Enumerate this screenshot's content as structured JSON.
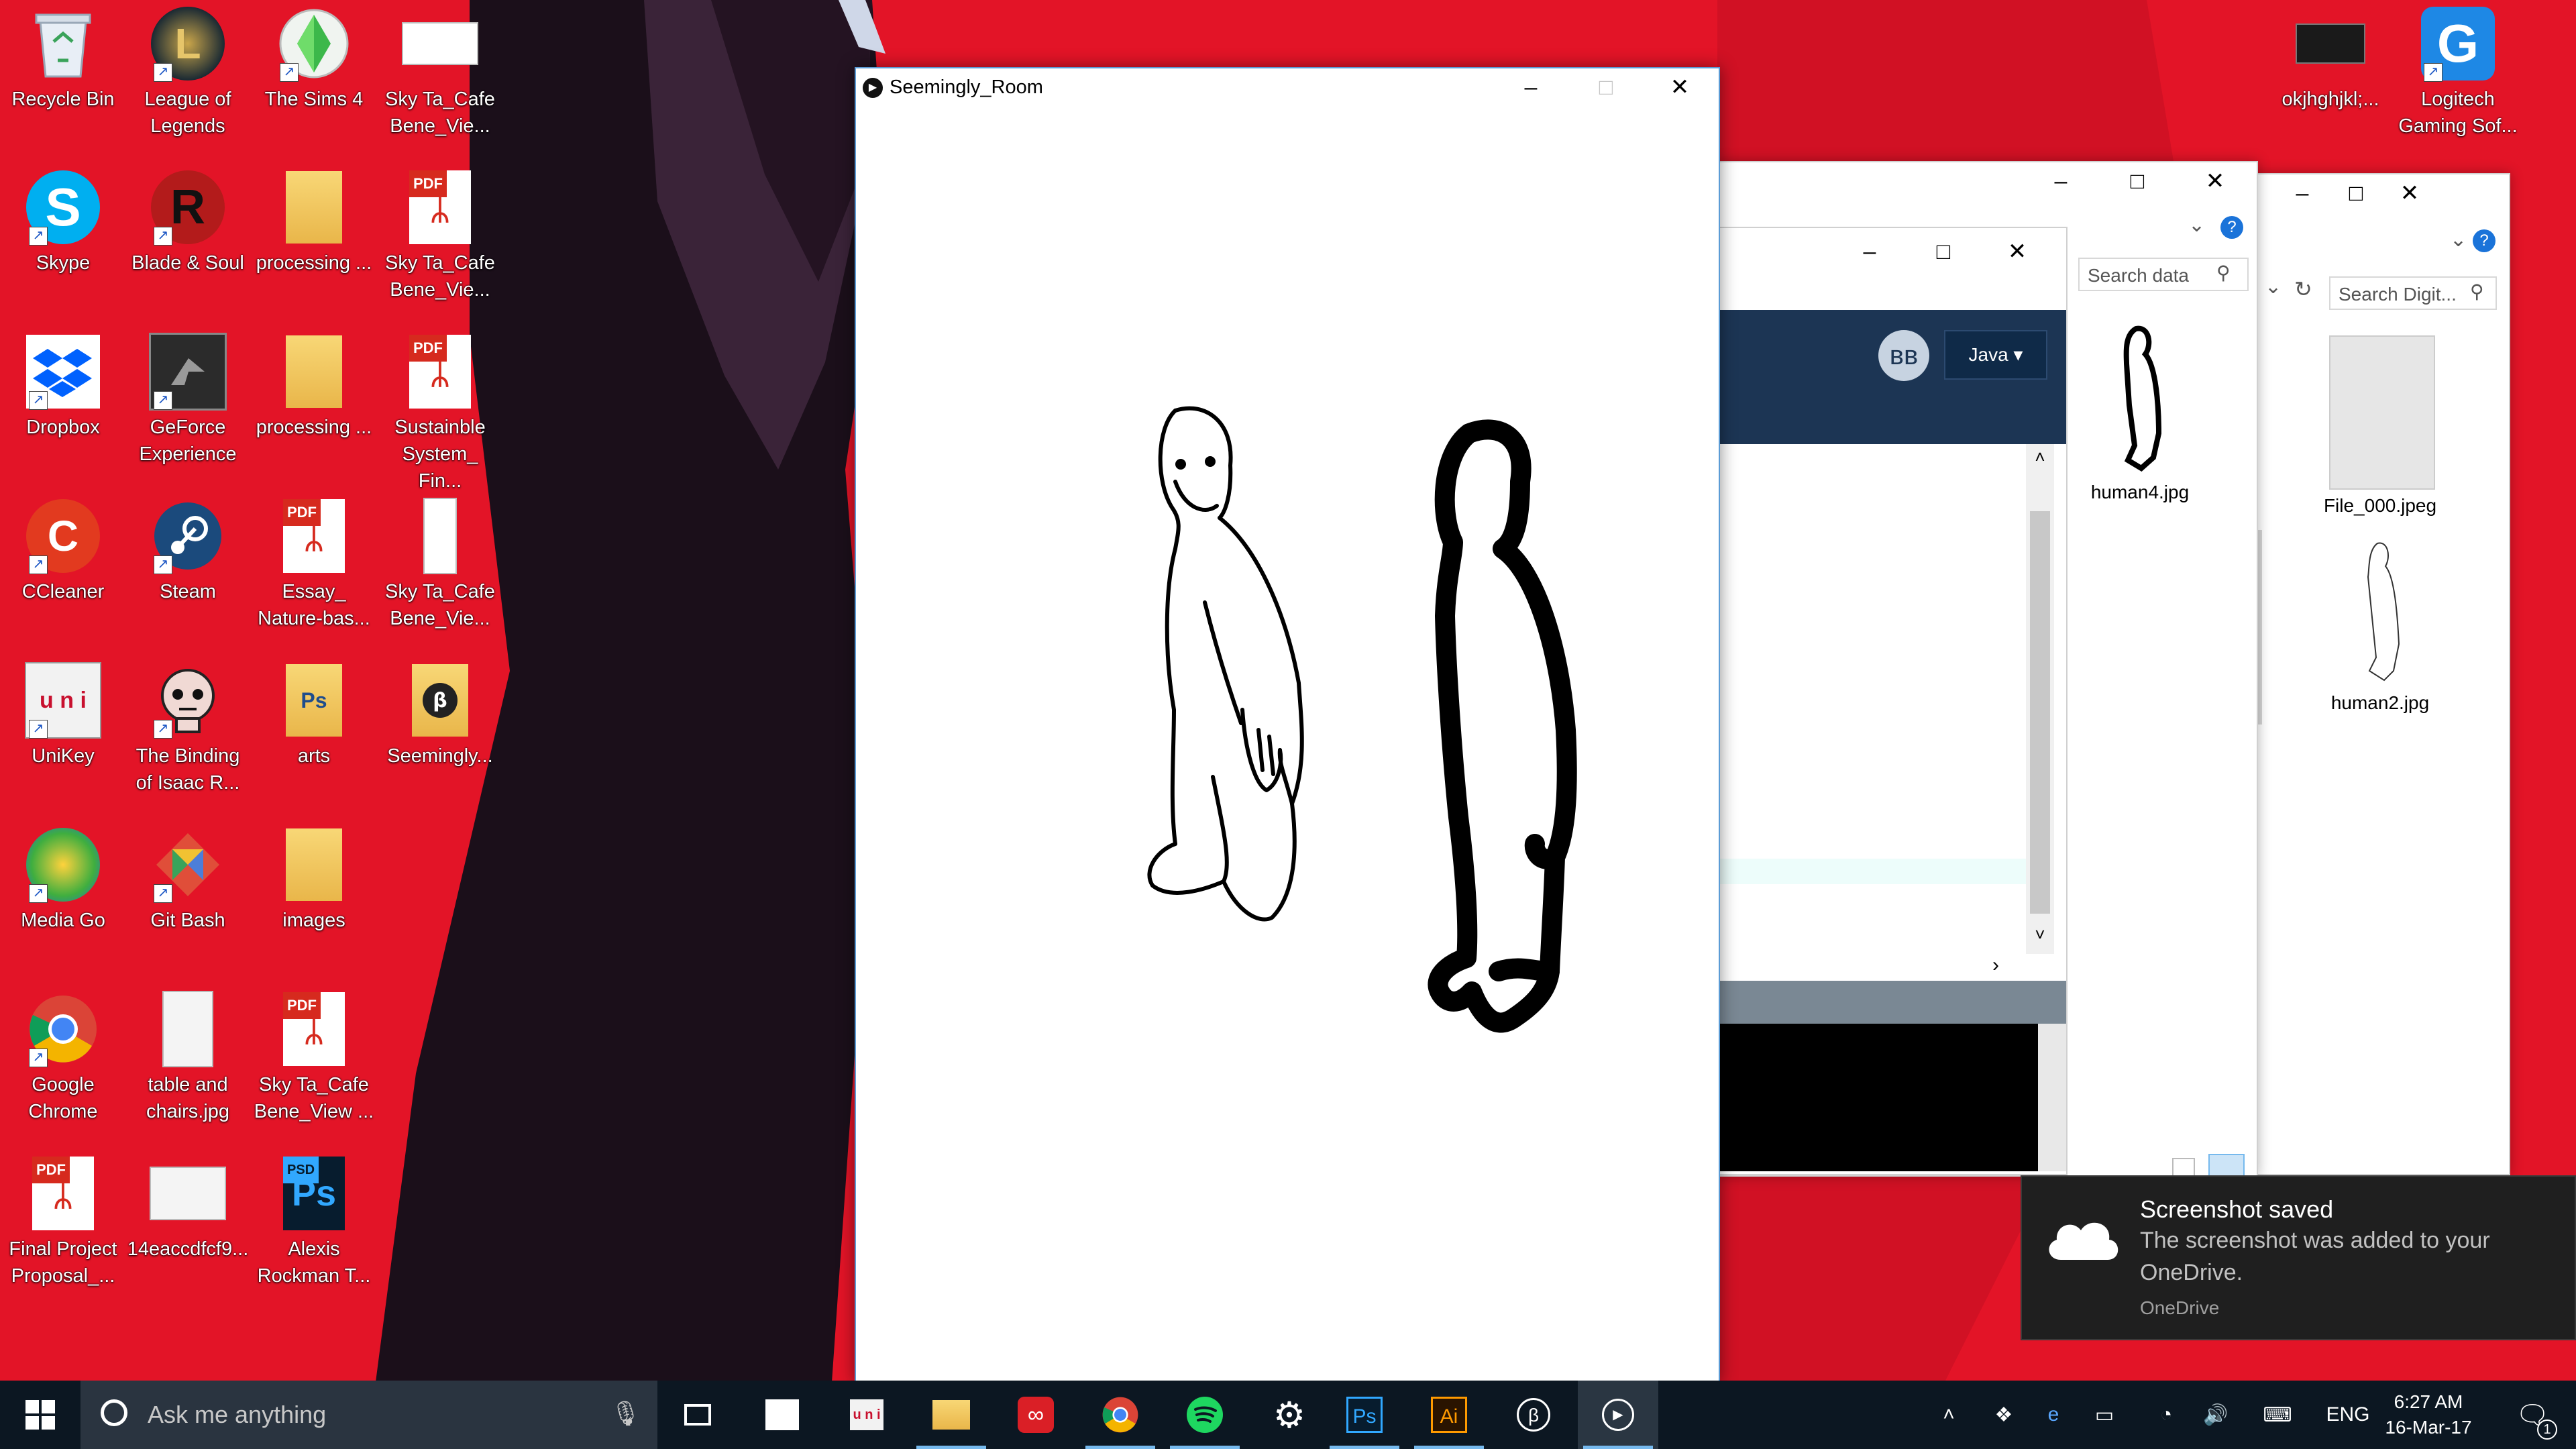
{
  "desktop": {
    "icons": [
      {
        "label_1": "Recycle Bin",
        "label_2": "",
        "icon": "recycle-bin-icon"
      },
      {
        "label_1": "League of",
        "label_2": "Legends",
        "icon": "league-of-legends-icon"
      },
      {
        "label_1": "The Sims 4",
        "label_2": "",
        "icon": "sims-plumbob-icon"
      },
      {
        "label_1": "Sky Ta_Cafe",
        "label_2": "Bene_Vie...",
        "icon": "image-file-icon"
      },
      {
        "label_1": "Skype",
        "label_2": "",
        "icon": "skype-icon"
      },
      {
        "label_1": "Blade & Soul",
        "label_2": "",
        "icon": "blade-and-soul-icon"
      },
      {
        "label_1": "processing ...",
        "label_2": "",
        "icon": "zip-folder-icon"
      },
      {
        "label_1": "Sky Ta_Cafe",
        "label_2": "Bene_Vie...",
        "icon": "pdf-file-icon"
      },
      {
        "label_1": "Dropbox",
        "label_2": "",
        "icon": "dropbox-icon"
      },
      {
        "label_1": "GeForce",
        "label_2": "Experience",
        "icon": "geforce-icon"
      },
      {
        "label_1": "processing ...",
        "label_2": "",
        "icon": "folder-icon"
      },
      {
        "label_1": "Sustainble",
        "label_2": "System_ Fin...",
        "icon": "pdf-file-icon"
      },
      {
        "label_1": "CCleaner",
        "label_2": "",
        "icon": "ccleaner-icon"
      },
      {
        "label_1": "Steam",
        "label_2": "",
        "icon": "steam-icon"
      },
      {
        "label_1": "Essay_",
        "label_2": "Nature-bas...",
        "icon": "pdf-file-icon"
      },
      {
        "label_1": "Sky Ta_Cafe",
        "label_2": "Bene_Vie...",
        "icon": "image-file-icon"
      },
      {
        "label_1": "UniKey",
        "label_2": "",
        "icon": "unikey-icon"
      },
      {
        "label_1": "The Binding",
        "label_2": "of Isaac R...",
        "icon": "binding-of-isaac-icon"
      },
      {
        "label_1": "arts",
        "label_2": "",
        "icon": "folder-icon"
      },
      {
        "label_1": "Seemingly...",
        "label_2": "",
        "icon": "processing-sketch-folder-icon"
      },
      {
        "label_1": "Media Go",
        "label_2": "",
        "icon": "media-go-icon"
      },
      {
        "label_1": "Git Bash",
        "label_2": "",
        "icon": "git-bash-icon"
      },
      {
        "label_1": "images",
        "label_2": "",
        "icon": "folder-icon"
      },
      {
        "label_1": "Google",
        "label_2": "Chrome",
        "icon": "chrome-icon"
      },
      {
        "label_1": "table and",
        "label_2": "chairs.jpg",
        "icon": "image-file-icon"
      },
      {
        "label_1": "Sky Ta_Cafe",
        "label_2": "Bene_View ...",
        "icon": "pdf-file-icon"
      },
      {
        "label_1": "Final Project",
        "label_2": "Proposal_...",
        "icon": "pdf-file-icon"
      },
      {
        "label_1": "14eaccdfcf9...",
        "label_2": "",
        "icon": "image-file-icon"
      },
      {
        "label_1": "Alexis",
        "label_2": "Rockman T...",
        "icon": "psd-file-icon"
      },
      {
        "label_1": "okjhghjkl;...",
        "label_2": "",
        "icon": "image-file-icon"
      },
      {
        "label_1": "Logitech",
        "label_2": "Gaming Sof...",
        "icon": "logitech-icon"
      }
    ],
    "badges": {
      "pdf": "PDF",
      "psd": "PSD",
      "ps": "Ps",
      "ai": "Ai",
      "unikey": "u n i"
    }
  },
  "sketch_window": {
    "title": "Seemingly_Room",
    "minimize": "–",
    "maximize": "□",
    "close": "✕"
  },
  "processing_ide": {
    "mode_label": "Java ▾",
    "logo": "ʙʙ"
  },
  "explorer_1": {
    "search_placeholder": "Search data",
    "file_name": "human4.jpg"
  },
  "explorer_2": {
    "search_placeholder": "Search Digit...",
    "files": [
      "File_000.jpeg",
      "human2.jpg"
    ]
  },
  "toast": {
    "title": "Screenshot saved",
    "body_1": "The screenshot was added to your",
    "body_2": "OneDrive.",
    "app": "OneDrive"
  },
  "taskbar": {
    "search_placeholder": "Ask me anything",
    "language": "ENG",
    "time": "6:27 AM",
    "date": "16-Mar-17",
    "notification_count": "1"
  },
  "colors": {
    "wallpaper_red": "#e01025",
    "taskbar": "#0c1722",
    "ide_blue": "#1c3554",
    "accent": "#76b9ed"
  }
}
